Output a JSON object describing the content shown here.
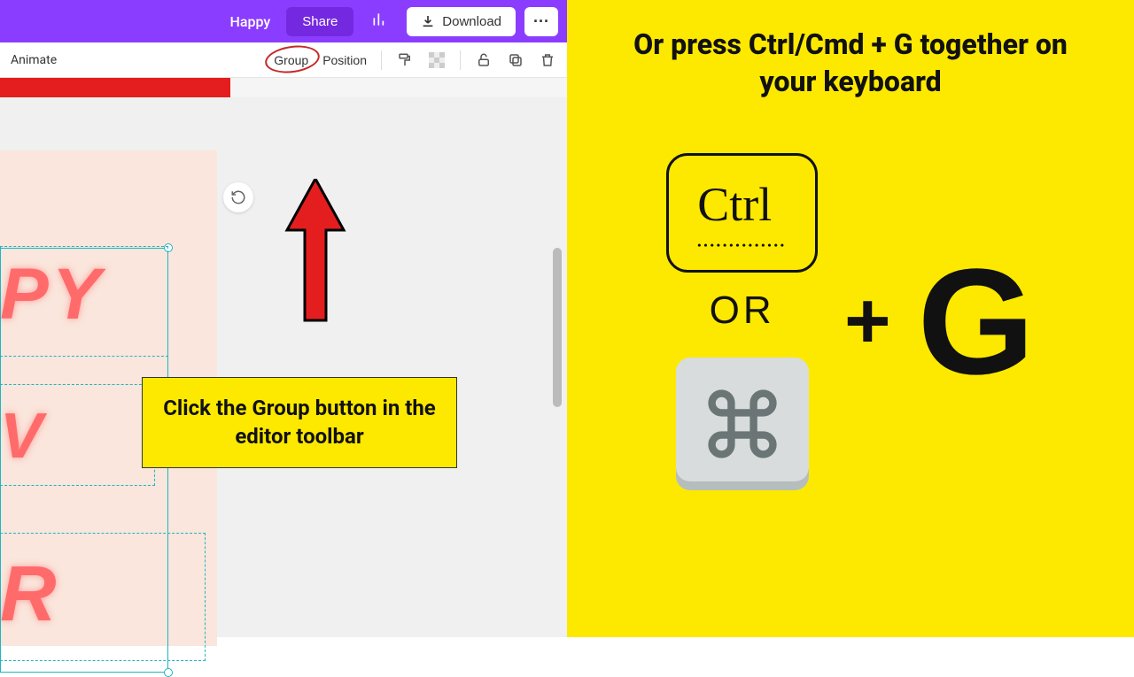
{
  "header": {
    "project_name": "Happy",
    "share_label": "Share",
    "download_label": "Download"
  },
  "toolbar": {
    "animate_label": "Animate",
    "group_label": "Group",
    "position_label": "Position"
  },
  "canvas": {
    "text1": "PY",
    "text2": "V",
    "text3": "R"
  },
  "annotation": {
    "callout_text": "Click the Group button in the editor toolbar"
  },
  "right": {
    "heading": "Or press Ctrl/Cmd + G together on your keyboard",
    "ctrl_label": "Ctrl",
    "or_label": "OR",
    "plus": "+",
    "g": "G"
  }
}
